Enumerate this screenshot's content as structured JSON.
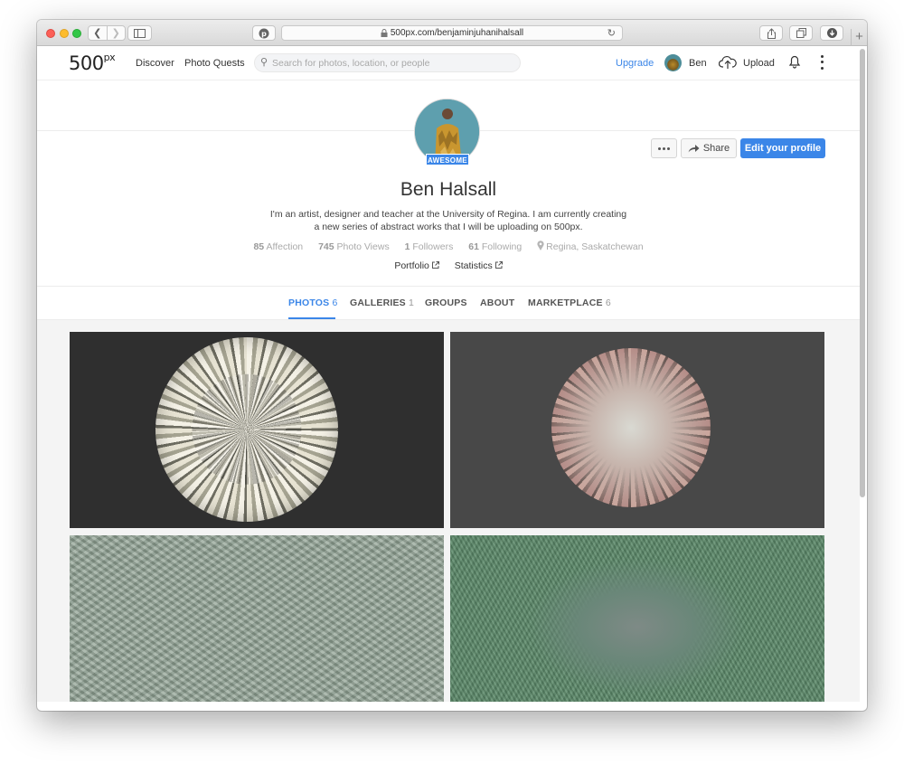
{
  "browser": {
    "url": "500px.com/benjaminjuhanihalsall"
  },
  "header": {
    "logo": "500",
    "logo_sup": "px",
    "nav": [
      "Discover",
      "Photo Quests"
    ],
    "search_placeholder": "Search for photos, location, or people",
    "upgrade": "Upgrade",
    "user": "Ben",
    "upload": "Upload"
  },
  "profile": {
    "badge": "AWESOME",
    "name": "Ben Halsall",
    "bio": "I'm an artist, designer and teacher at the University of Regina. I am currently creating a new series of abstract works that I will be uploading on 500px.",
    "stats": [
      {
        "value": "85",
        "label": "Affection"
      },
      {
        "value": "745",
        "label": "Photo Views"
      },
      {
        "value": "1",
        "label": "Followers"
      },
      {
        "value": "61",
        "label": "Following"
      }
    ],
    "location": "Regina, Saskatchewan",
    "links": [
      "Portfolio",
      "Statistics"
    ],
    "share_label": "Share",
    "edit_label": "Edit your profile"
  },
  "tabs": [
    {
      "label": "PHOTOS",
      "count": "6",
      "active": true
    },
    {
      "label": "GALLERIES",
      "count": "1",
      "active": false
    },
    {
      "label": "GROUPS",
      "count": "",
      "active": false
    },
    {
      "label": "ABOUT",
      "count": "",
      "active": false
    },
    {
      "label": "MARKETPLACE",
      "count": "6",
      "active": false
    }
  ],
  "colors": {
    "accent": "#3b86e8",
    "text": "#333333",
    "muted": "#aaaaaa"
  }
}
